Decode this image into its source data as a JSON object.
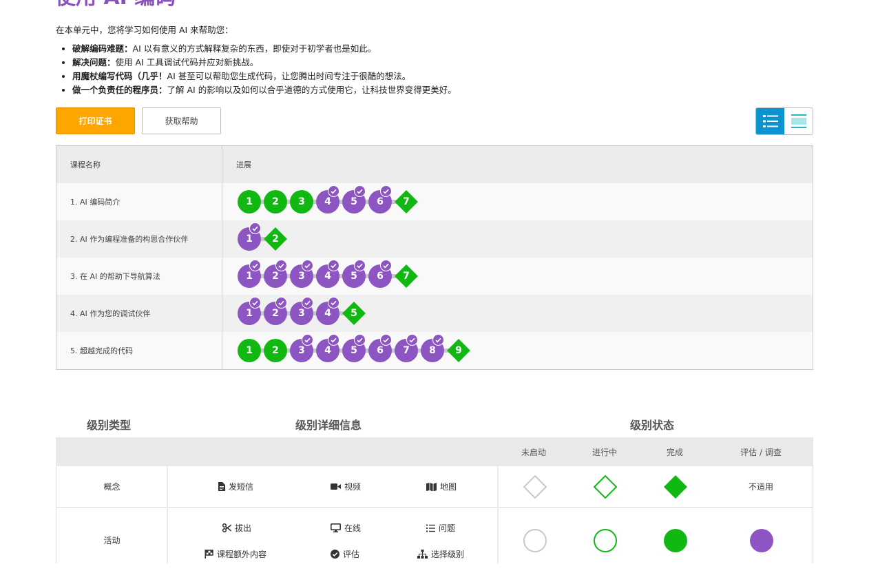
{
  "page_title": "使用 AI 编码",
  "intro": "在本单元中，您将学习如何使用 AI 来帮助您：",
  "bullets": [
    {
      "bold": "破解编码难题：",
      "text": "AI 以有意义的方式解释复杂的东西，即使对于初学者也是如此。"
    },
    {
      "bold": "解决问题：",
      "text": "使用 AI 工具调试代码并应对新挑战。"
    },
    {
      "bold": "用魔杖编写代码（几乎！",
      "text": "AI 甚至可以帮助您生成代码，让您腾出时间专注于很酷的想法。"
    },
    {
      "bold": "做一个负责任的程序员：",
      "text": "了解 AI 的影响以及如何以合乎道德的方式使用它，让科技世界变得更美好。"
    }
  ],
  "buttons": {
    "print": "打印证书",
    "help": "获取帮助"
  },
  "view_toggle": {
    "active": "list-view-icon",
    "inactive": "summary-view-icon"
  },
  "progress_table": {
    "header": {
      "name": "课程名称",
      "progress": "进展"
    },
    "lessons": [
      {
        "name": "1. AI 编码简介",
        "levels": [
          {
            "label": "1",
            "status": "complete",
            "kind": "bubble"
          },
          {
            "label": "2",
            "status": "complete",
            "kind": "bubble"
          },
          {
            "label": "3",
            "status": "complete",
            "kind": "bubble"
          },
          {
            "label": "4",
            "status": "assessment",
            "kind": "bubble"
          },
          {
            "label": "5",
            "status": "assessment",
            "kind": "bubble"
          },
          {
            "label": "6",
            "status": "assessment",
            "kind": "bubble"
          },
          {
            "label": "7",
            "status": "complete",
            "kind": "diamond"
          }
        ]
      },
      {
        "name": "2. AI 作为编程准备的构思合作伙伴",
        "levels": [
          {
            "label": "1",
            "status": "assessment",
            "kind": "bubble"
          },
          {
            "label": "2",
            "status": "complete",
            "kind": "diamond"
          }
        ]
      },
      {
        "name": "3. 在 AI 的帮助下导航算法",
        "levels": [
          {
            "label": "1",
            "status": "assessment",
            "kind": "bubble"
          },
          {
            "label": "2",
            "status": "assessment",
            "kind": "bubble"
          },
          {
            "label": "3",
            "status": "assessment",
            "kind": "bubble"
          },
          {
            "label": "4",
            "status": "assessment",
            "kind": "bubble"
          },
          {
            "label": "5",
            "status": "assessment",
            "kind": "bubble"
          },
          {
            "label": "6",
            "status": "assessment",
            "kind": "bubble"
          },
          {
            "label": "7",
            "status": "complete",
            "kind": "diamond"
          }
        ]
      },
      {
        "name": "4. AI 作为您的调试伙伴",
        "levels": [
          {
            "label": "1",
            "status": "assessment",
            "kind": "bubble"
          },
          {
            "label": "2",
            "status": "assessment",
            "kind": "bubble"
          },
          {
            "label": "3",
            "status": "assessment",
            "kind": "bubble"
          },
          {
            "label": "4",
            "status": "assessment",
            "kind": "bubble"
          },
          {
            "label": "5",
            "status": "complete",
            "kind": "diamond"
          }
        ]
      },
      {
        "name": "5. 超越完成的代码",
        "levels": [
          {
            "label": "1",
            "status": "complete",
            "kind": "bubble"
          },
          {
            "label": "2",
            "status": "complete",
            "kind": "bubble"
          },
          {
            "label": "3",
            "status": "assessment",
            "kind": "bubble"
          },
          {
            "label": "4",
            "status": "assessment",
            "kind": "bubble"
          },
          {
            "label": "5",
            "status": "assessment",
            "kind": "bubble"
          },
          {
            "label": "6",
            "status": "assessment",
            "kind": "bubble"
          },
          {
            "label": "7",
            "status": "assessment",
            "kind": "bubble"
          },
          {
            "label": "8",
            "status": "assessment",
            "kind": "bubble"
          },
          {
            "label": "9",
            "status": "complete",
            "kind": "diamond"
          }
        ]
      }
    ]
  },
  "legend": {
    "headings": {
      "type": "级别类型",
      "details": "级别详细信息",
      "status": "级别状态"
    },
    "status_columns": [
      "未启动",
      "进行中",
      "完成",
      "评估 / 调查"
    ],
    "rows": [
      {
        "type": "概念",
        "details": [
          {
            "icon": "file-text-icon",
            "label": "发短信"
          },
          {
            "icon": "video-icon",
            "label": "视频"
          },
          {
            "icon": "map-icon",
            "label": "地图"
          }
        ],
        "not_applicable": "不适用"
      },
      {
        "type": "活动",
        "details": [
          {
            "icon": "scissors-icon",
            "label": "拔出"
          },
          {
            "icon": "desktop-icon",
            "label": "在线"
          },
          {
            "icon": "list-icon",
            "label": "问题"
          },
          {
            "icon": "flag-icon",
            "label": "课程额外内容"
          },
          {
            "icon": "check-circle-icon",
            "label": "评估"
          },
          {
            "icon": "sitemap-icon",
            "label": "选择级别"
          }
        ]
      }
    ]
  },
  "colors": {
    "title": "#8c50c0",
    "complete": "#11b811",
    "assessment": "#8c55c2",
    "print_button": "#ffa500",
    "toggle_active": "#0e93d1"
  }
}
